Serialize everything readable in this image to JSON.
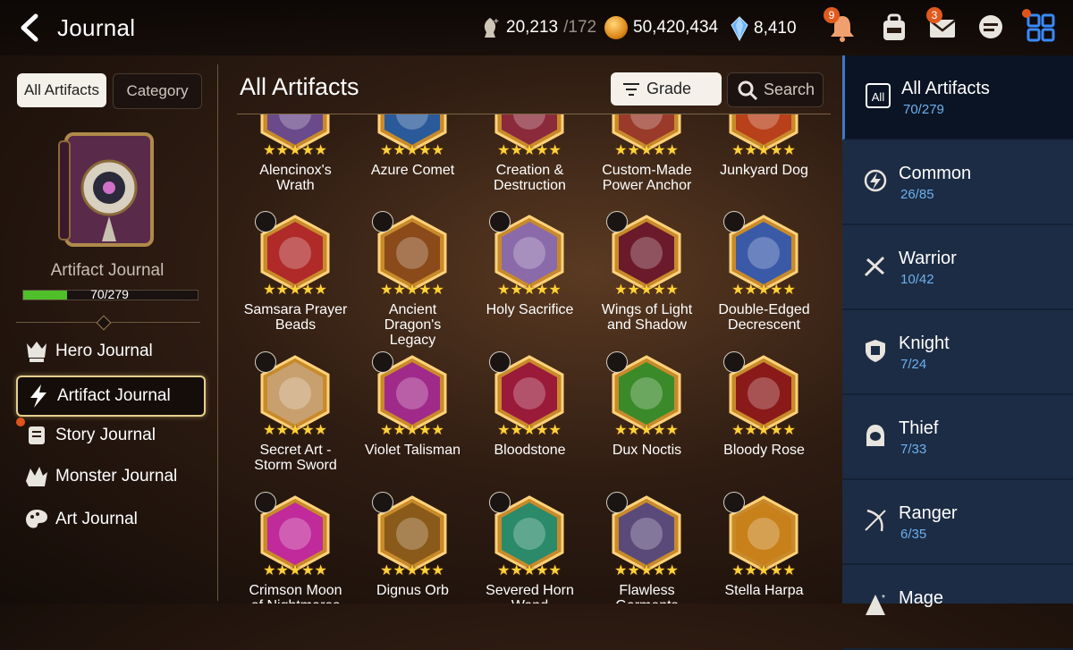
{
  "header": {
    "title": "Journal",
    "stamina": "20,213",
    "stamina_max": "/172",
    "gold": "50,420,434",
    "crystals": "8,410",
    "notif_badge": "9",
    "mail_badge": "3"
  },
  "sidebar": {
    "tab_all": "All Artifacts",
    "tab_category": "Category",
    "journal_label": "Artifact Journal",
    "progress_text": "70/279",
    "progress_fraction": 0.251,
    "nav": [
      {
        "label": "Hero Journal",
        "icon": "hero-icon"
      },
      {
        "label": "Artifact Journal",
        "icon": "lightning-icon"
      },
      {
        "label": "Story Journal",
        "icon": "scroll-icon"
      },
      {
        "label": "Monster Journal",
        "icon": "monster-icon"
      },
      {
        "label": "Art Journal",
        "icon": "palette-icon"
      }
    ]
  },
  "main": {
    "title": "All Artifacts",
    "grade_label": "Grade",
    "search_label": "Search",
    "artifacts": [
      {
        "name": "Alencinox's\nWrath",
        "color": "#6a4a8a"
      },
      {
        "name": "Azure Comet",
        "color": "#2a5a9a"
      },
      {
        "name": "Creation &\nDestruction",
        "color": "#8a2a3a"
      },
      {
        "name": "Custom-Made\nPower Anchor",
        "color": "#9a3a2a"
      },
      {
        "name": "Junkyard Dog",
        "color": "#b8401a"
      },
      {
        "name": "Samsara Prayer\nBeads",
        "color": "#b02a2a"
      },
      {
        "name": "Ancient\nDragon's\nLegacy",
        "color": "#8a4a1a"
      },
      {
        "name": "Holy Sacrifice",
        "color": "#8a6aa8"
      },
      {
        "name": "Wings of Light\nand Shadow",
        "color": "#6a1a2a"
      },
      {
        "name": "Double-Edged\nDecrescent",
        "color": "#3a5aa8"
      },
      {
        "name": "Secret Art -\nStorm Sword",
        "color": "#c8a070"
      },
      {
        "name": "Violet Talisman",
        "color": "#a02a8a"
      },
      {
        "name": "Bloodstone",
        "color": "#9a1a3a"
      },
      {
        "name": "Dux Noctis",
        "color": "#3a8a2a"
      },
      {
        "name": "Bloody Rose",
        "color": "#8a1a1a"
      },
      {
        "name": "Crimson Moon\nof Nightmares",
        "color": "#c02a9a"
      },
      {
        "name": "Dignus Orb",
        "color": "#8a5a1a"
      },
      {
        "name": "Severed Horn\nWand",
        "color": "#2a8a6a"
      },
      {
        "name": "Flawless\nGarments",
        "color": "#5a4a7a"
      },
      {
        "name": "Stella Harpa",
        "color": "#c8801a"
      }
    ]
  },
  "categories": [
    {
      "label": "All Artifacts",
      "count": "70/279",
      "icon": "all-icon"
    },
    {
      "label": "Common",
      "count": "26/85",
      "icon": "common-icon"
    },
    {
      "label": "Warrior",
      "count": "10/42",
      "icon": "warrior-icon"
    },
    {
      "label": "Knight",
      "count": "7/24",
      "icon": "knight-icon"
    },
    {
      "label": "Thief",
      "count": "7/33",
      "icon": "thief-icon"
    },
    {
      "label": "Ranger",
      "count": "6/35",
      "icon": "ranger-icon"
    },
    {
      "label": "Mage",
      "count": "",
      "icon": "mage-icon"
    }
  ],
  "icons": {
    "all": "All"
  }
}
